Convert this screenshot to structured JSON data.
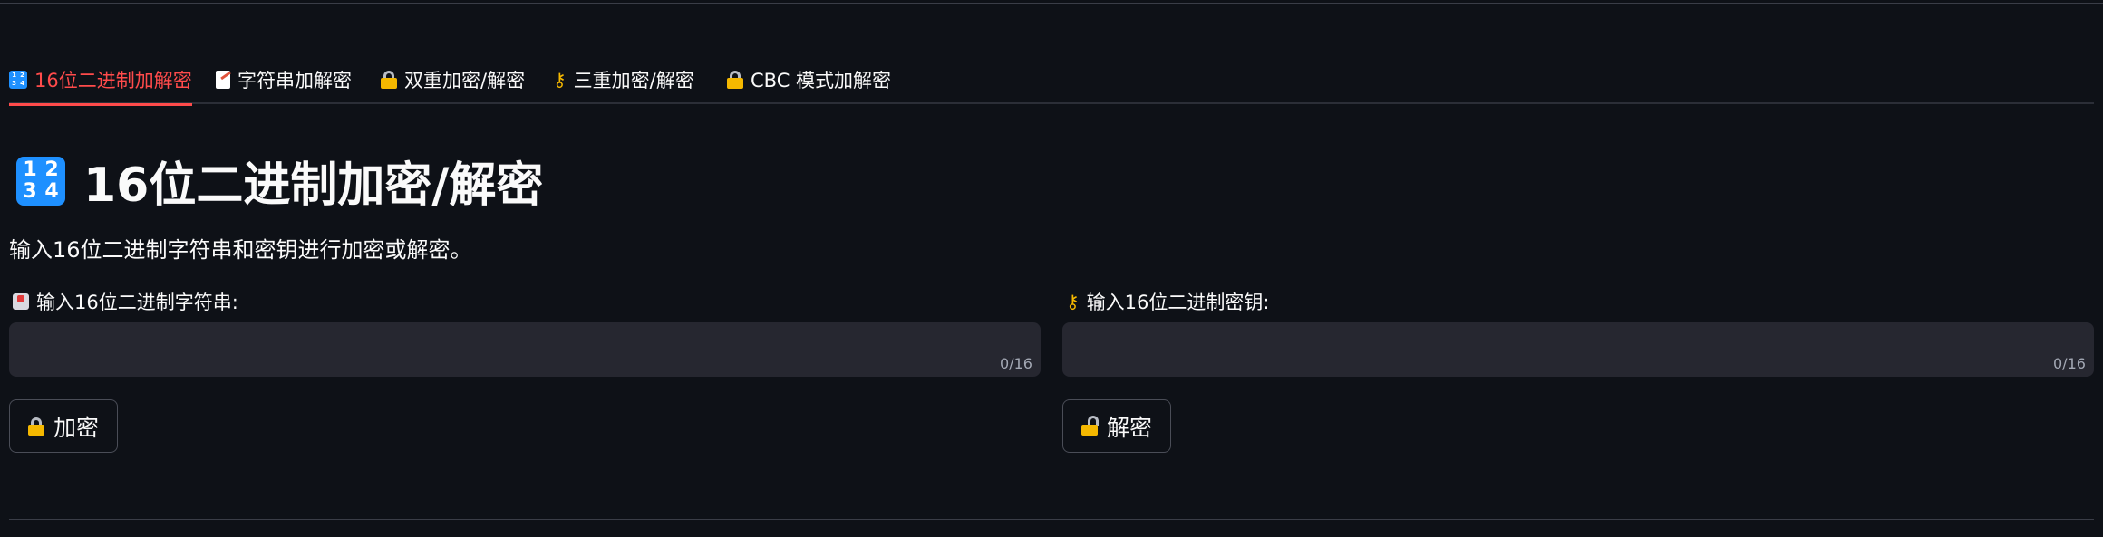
{
  "tabs": [
    {
      "label": "16位二进制加解密",
      "icon": "input-numbers-icon",
      "active": true
    },
    {
      "label": "字符串加解密",
      "icon": "memo-icon",
      "active": false
    },
    {
      "label": "双重加密/解密",
      "icon": "locked-with-pen-icon",
      "active": false
    },
    {
      "label": "三重加密/解密",
      "icon": "key-icon",
      "active": false
    },
    {
      "label": "CBC 模式加解密",
      "icon": "lock-icon",
      "active": false
    }
  ],
  "header": {
    "title": "16位二进制加密/解密",
    "description": "输入16位二进制字符串和密钥进行加密或解密。"
  },
  "form": {
    "plaintext_label": "输入16位二进制字符串:",
    "plaintext_value": "",
    "plaintext_counter": "0/16",
    "key_label": "输入16位二进制密钥:",
    "key_value": "",
    "key_counter": "0/16",
    "encrypt_label": "加密",
    "decrypt_label": "解密"
  },
  "colors": {
    "background": "#0e1117",
    "accent": "#ff4b4b",
    "input_bg": "#262730"
  }
}
